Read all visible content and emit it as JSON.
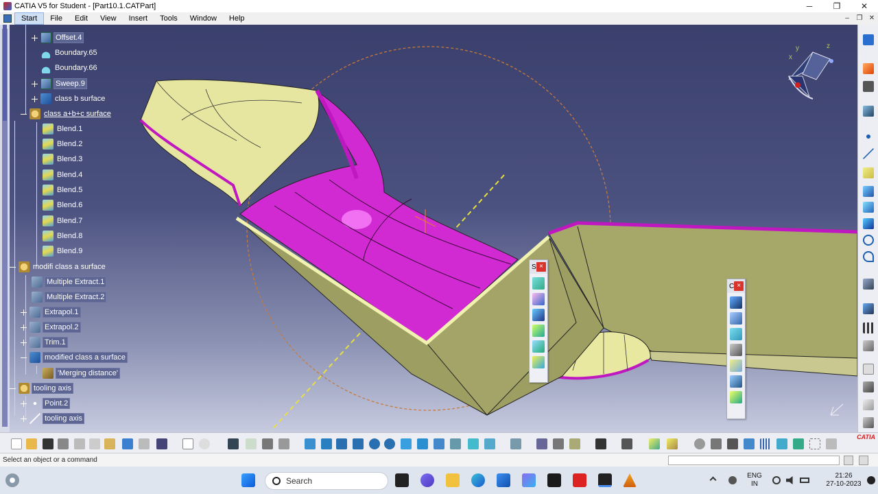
{
  "window": {
    "title": "CATIA V5 for Student - [Part10.1.CATPart]",
    "minimize": "─",
    "restore": "❐",
    "close": "✕"
  },
  "menu": {
    "items": [
      "Start",
      "File",
      "Edit",
      "View",
      "Insert",
      "Tools",
      "Window",
      "Help"
    ],
    "active": "Start",
    "mdi_minimize": "–",
    "mdi_restore": "❐",
    "mdi_close": "✕"
  },
  "tree": {
    "offset": "Offset.4",
    "boundary1": "Boundary.65",
    "boundary2": "Boundary.66",
    "sweep": "Sweep.9",
    "class_b": "class b surface",
    "class_abc": "class  a+b+c surface",
    "blends": [
      "Blend.1",
      "Blend.2",
      "Blend.3",
      "Blend.4",
      "Blend.5",
      "Blend.6",
      "Blend.7",
      "Blend.8",
      "Blend.9"
    ],
    "modifi": "modifi class a surface",
    "extract1": "Multiple Extract.1",
    "extract2": "Multiple Extract.2",
    "extrapol1": "Extrapol.1",
    "extrapol2": "Extrapol.2",
    "trim": "Trim.1",
    "modified": "modified class a surface",
    "merging": "'Merging distance'",
    "tooling": "tooling axis",
    "point": "Point.2",
    "tooling_line": "tooling axis"
  },
  "float_toolbars": {
    "left_title": "S",
    "right_title": "C",
    "close": "×"
  },
  "compass": {
    "x": "x",
    "y": "y",
    "z": "z"
  },
  "status": {
    "message": "Select an object or a command"
  },
  "taskbar": {
    "search_placeholder": "Search",
    "lang1": "ENG",
    "lang2": "IN",
    "time": "21:26",
    "date": "27-10-2023"
  },
  "brand": {
    "logo": "CATIA"
  },
  "colors": {
    "viewport_top": "#3a3f6c",
    "surface_olive": "#a8a86c",
    "surface_magenta": "#d020d0",
    "surface_cream": "#f0f0a8"
  }
}
